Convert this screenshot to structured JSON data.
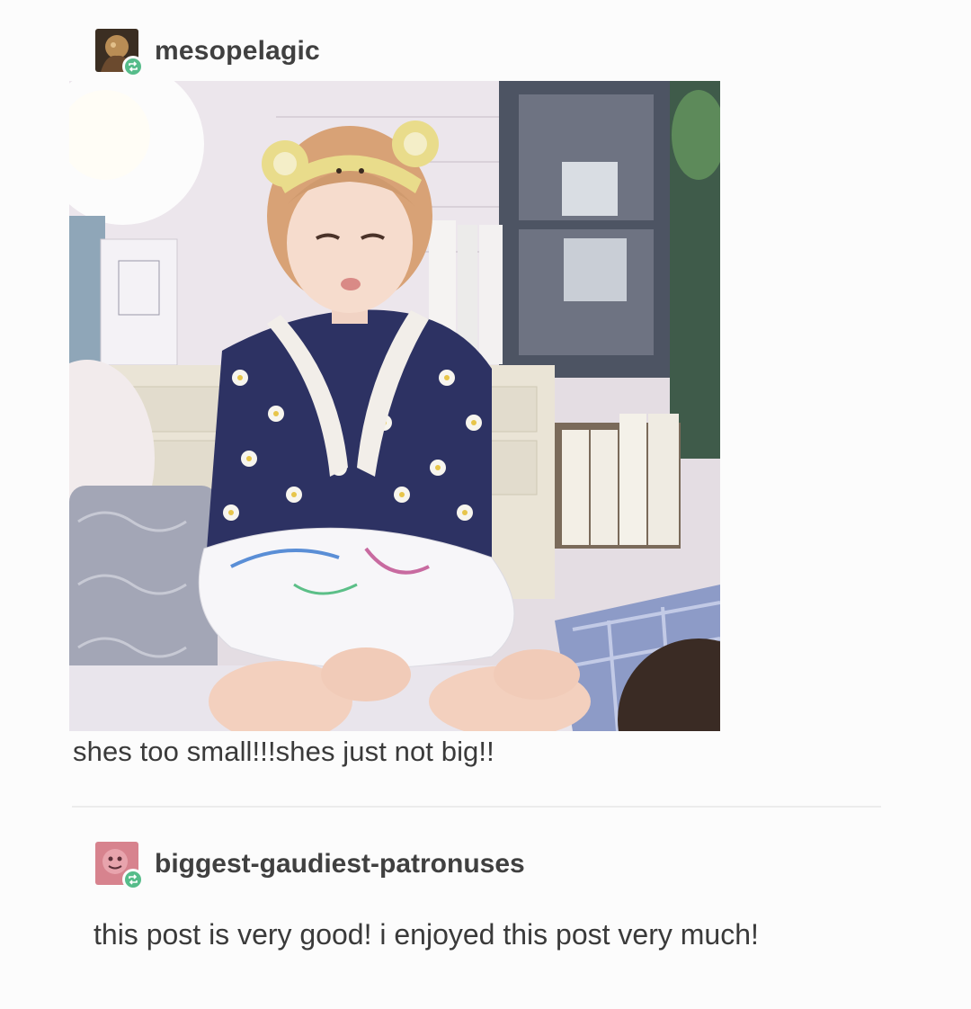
{
  "post": {
    "author": "mesopelagic",
    "caption": "shes too small!!!shes just not big!!",
    "photo": {
      "alt": "Girl in a yellow bear-ear headband and navy daisy-print dress sitting with a pillow"
    }
  },
  "reply": {
    "author": "biggest-gaudiest-patronuses",
    "text": "this post is very good! i enjoyed this post very much!"
  },
  "colors": {
    "reblog_badge": "#56bc8a",
    "text": "#3a3a3a",
    "background": "#fcfcfc"
  },
  "icons": {
    "reblog_badge": "reblog-icon"
  }
}
